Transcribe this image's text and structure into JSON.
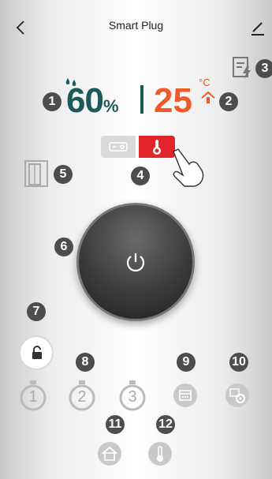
{
  "header": {
    "title": "Smart Plug"
  },
  "readings": {
    "humidity_value": "60",
    "humidity_unit": "%",
    "temperature_value": "25",
    "temperature_unit": "°C"
  },
  "callouts": [
    "1",
    "2",
    "3",
    "4",
    "5",
    "6",
    "7",
    "8",
    "9",
    "10",
    "11",
    "12"
  ],
  "timers": [
    "1",
    "2",
    "3"
  ],
  "colors": {
    "humidity": "#1c5a5a",
    "temperature": "#f05a28",
    "badge": "#4d4d4d",
    "heat_mode": "#e0242a",
    "icon_gray": "#c9c9c9"
  },
  "icons": {
    "back": "chevron-left-icon",
    "edit": "pencil-icon",
    "energy": "energy-report-icon",
    "switch_mode": "switch-mode-icon",
    "thermostat_mode": "thermostat-mode-icon",
    "door": "door-icon",
    "power": "power-icon",
    "lock": "lock-icon",
    "schedule": "calendar-icon",
    "schedule_settings": "calendar-gear-icon",
    "home": "home-temperature-icon",
    "thermometer": "thermometer-icon"
  }
}
